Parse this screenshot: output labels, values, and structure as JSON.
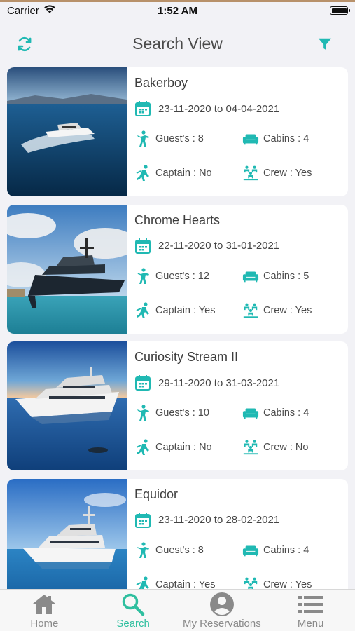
{
  "status": {
    "carrier": "Carrier",
    "time": "1:52 AM"
  },
  "header": {
    "title": "Search View",
    "left_icon": "refresh-icon",
    "right_icon": "filter-icon"
  },
  "colors": {
    "accent": "#20b9b3",
    "tab_active": "#2fbf9f",
    "tab_inactive": "#8a8a8a"
  },
  "yachts": [
    {
      "name": "Bakerboy",
      "dates": "23-11-2020 to 04-04-2021",
      "guests": "Guest's : 8",
      "cabins": "Cabins : 4",
      "captain": "Captain : No",
      "crew": "Crew : Yes"
    },
    {
      "name": "Chrome Hearts",
      "dates": "22-11-2020 to 31-01-2021",
      "guests": "Guest's : 12",
      "cabins": "Cabins : 5",
      "captain": "Captain : Yes",
      "crew": "Crew : Yes"
    },
    {
      "name": "Curiosity Stream II",
      "dates": "29-11-2020 to 31-03-2021",
      "guests": "Guest's : 10",
      "cabins": "Cabins : 4",
      "captain": "Captain : No",
      "crew": "Crew : No"
    },
    {
      "name": "Equidor",
      "dates": "23-11-2020 to 28-02-2021",
      "guests": "Guest's : 8",
      "cabins": "Cabins : 4",
      "captain": "Captain : Yes",
      "crew": "Crew : Yes"
    }
  ],
  "tabs": [
    {
      "label": "Home",
      "icon": "home-icon"
    },
    {
      "label": "Search",
      "icon": "search-icon",
      "active": true
    },
    {
      "label": "My Reservations",
      "icon": "account-icon"
    },
    {
      "label": "Menu",
      "icon": "menu-icon"
    }
  ]
}
